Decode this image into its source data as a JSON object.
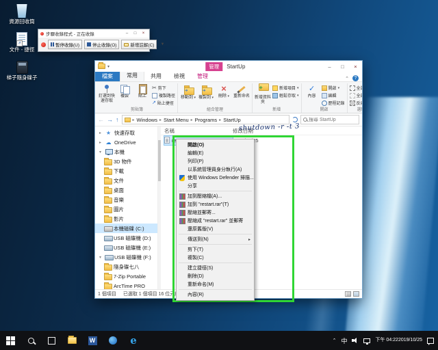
{
  "colors": {
    "annotation_green": "#2fd633",
    "app_tools_pink": "#d6418f",
    "file_tab_blue": "#2b79c2",
    "selection_blue": "#cce8ff"
  },
  "desktop": {
    "icons": [
      {
        "label": "資源回收筒"
      },
      {
        "label": "文件 - 捷徑"
      },
      {
        "label": "梯子隨身碟子"
      }
    ]
  },
  "recorder": {
    "title": "步驟收錄程式 - 正在收錄",
    "pause_label": "暫停收錄(U)",
    "stop_label": "停止收錄(O)",
    "add_comment_label": "新增註解(C)"
  },
  "explorer": {
    "title": "StartUp",
    "context_header": "管理",
    "tabs": {
      "file": "檔案",
      "home": "常用",
      "share": "共用",
      "view": "檢視",
      "manage": "管理"
    },
    "ribbon": {
      "groups": [
        "剪貼簿",
        "組合管理",
        "新增",
        "開啟",
        "選取"
      ],
      "pin": "釘選到快速存取",
      "copy": "複製",
      "paste": "貼上",
      "cut": "剪下",
      "copy_path": "複製路徑",
      "paste_shortcut": "貼上捷徑",
      "move_to": "移動到",
      "copy_to": "複製到",
      "delete": "刪除",
      "rename": "重新命名",
      "new_folder": "新增資料夾",
      "new_item": "新增項目",
      "easy_access": "輕鬆存取",
      "properties": "內容",
      "open": "開啟",
      "edit": "編輯",
      "history": "歷程記錄",
      "select_all": "全選",
      "select_none": "全部不選",
      "invert_selection": "反向選擇"
    },
    "address": {
      "crumbs": [
        "Windows",
        "Start Menu",
        "Programs",
        "StartUp"
      ],
      "search_placeholder": "搜尋 StartUp"
    },
    "columns": {
      "name": "名稱",
      "date_modified": "修改日期"
    },
    "file": {
      "name": "restart",
      "date_modified": "2019/10/25"
    },
    "sidebar": {
      "items": [
        {
          "label": "快速存取"
        },
        {
          "label": "OneDrive"
        },
        {
          "label": "本機"
        },
        {
          "label": "3D 物件"
        },
        {
          "label": "下載"
        },
        {
          "label": "文件"
        },
        {
          "label": "桌面"
        },
        {
          "label": "音樂"
        },
        {
          "label": "圖片"
        },
        {
          "label": "影片"
        },
        {
          "label": "本機磁碟 (C:)"
        },
        {
          "label": "USB 磁碟機 (D:)"
        },
        {
          "label": "USB 磁碟機 (E:)"
        },
        {
          "label": "USB 磁碟機 (F:)"
        },
        {
          "label": "隨身碟七八"
        },
        {
          "label": "7-Zip Portable"
        },
        {
          "label": "ArcTime PRO"
        }
      ]
    },
    "status": {
      "items_count": "1 個項目",
      "selection": "已選取 1 個項目 16 位元組"
    }
  },
  "context_menu": {
    "items": [
      {
        "label": "開啟(O)"
      },
      {
        "label": "編輯(E)"
      },
      {
        "label": "列印(P)"
      },
      {
        "label": "以系統管理員身分執行(A)"
      },
      {
        "label": "使用 Windows Defender 掃描..."
      },
      {
        "label": "分享"
      },
      {
        "label": "加到壓縮檔(A)..."
      },
      {
        "label": "加到 \"restart.rar\"(T)"
      },
      {
        "label": "壓縮並郵寄..."
      },
      {
        "label": "壓縮成 \"restart.rar\" 並郵寄"
      },
      {
        "label": "還原舊版(V)"
      },
      {
        "label": "傳送到(N)"
      },
      {
        "label": "剪下(T)"
      },
      {
        "label": "複製(C)"
      },
      {
        "label": "建立捷徑(S)"
      },
      {
        "label": "刪除(D)"
      },
      {
        "label": "重新命名(M)"
      },
      {
        "label": "內容(R)"
      }
    ]
  },
  "annotation": {
    "text": "shutdown -r -t 3"
  },
  "taskbar": {
    "ime_indicator": "中",
    "clock_time": "下午 04:22",
    "clock_date": "2019/10/25",
    "word_glyph": "W",
    "edge_glyph": "e"
  }
}
